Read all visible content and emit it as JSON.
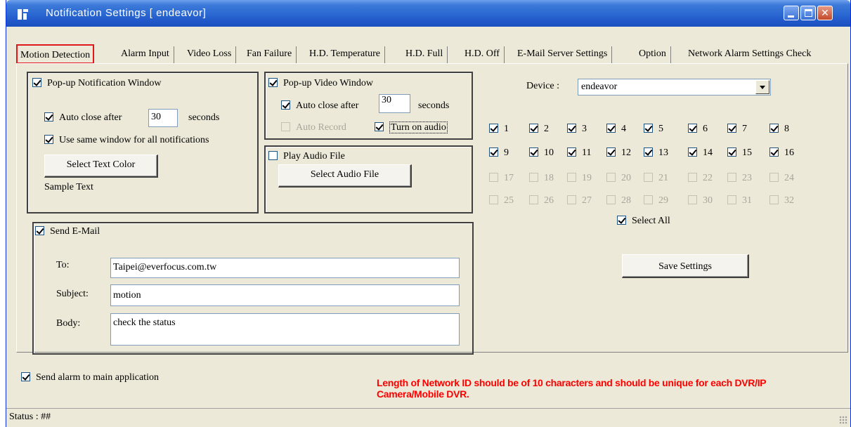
{
  "window": {
    "title": "Notification Settings  [ endeavor]"
  },
  "tabs": [
    {
      "label": "Motion Detection",
      "active": true
    },
    {
      "label": "Alarm Input"
    },
    {
      "label": "Video Loss"
    },
    {
      "label": "Fan Failure"
    },
    {
      "label": "H.D. Temperature"
    },
    {
      "label": "H.D. Full"
    },
    {
      "label": "H.D. Off"
    },
    {
      "label": "E-Mail Server Settings"
    },
    {
      "label": "Option"
    },
    {
      "label": "Network Alarm Settings Check"
    }
  ],
  "popup_notification": {
    "label": "Pop-up Notification Window",
    "checked": true,
    "auto_close_label": "Auto close after",
    "auto_close_value": "30",
    "seconds_label": "seconds",
    "same_window_label": "Use same window for all notifications",
    "select_color_button": "Select Text Color",
    "sample_text": "Sample Text"
  },
  "popup_video": {
    "label": "Pop-up Video Window",
    "auto_close_label": "Auto close after",
    "auto_close_value": "30",
    "seconds_label": "seconds",
    "auto_record_label": "Auto Record",
    "turn_on_audio_label": "Turn on audio"
  },
  "play_audio": {
    "label": "Play Audio File",
    "button": "Select Audio File"
  },
  "send_email": {
    "label": "Send E-Mail",
    "to_label": "To:",
    "to_value": "Taipei@everfocus.com.tw",
    "subject_label": "Subject:",
    "subject_value": "motion",
    "body_label": "Body:",
    "body_value": "check the status"
  },
  "device": {
    "label": "Device :",
    "value": "endeavor"
  },
  "channels": {
    "labels": [
      "1",
      "2",
      "3",
      "4",
      "5",
      "6",
      "7",
      "8",
      "9",
      "10",
      "11",
      "12",
      "13",
      "14",
      "15",
      "16",
      "17",
      "18",
      "19",
      "20",
      "21",
      "22",
      "23",
      "24",
      "25",
      "26",
      "27",
      "28",
      "29",
      "30",
      "31",
      "32"
    ],
    "checked_count": 16,
    "select_all_label": "Select All"
  },
  "save_button": "Save Settings",
  "send_alarm_label": "Send alarm to main application",
  "warning_line1": "Length of Network ID should be of 10 characters and should be unique for each DVR/IP",
  "warning_line2": "Camera/Mobile DVR.",
  "status_text": "Status : ##",
  "colors": {
    "titlebar": "#2a67d2",
    "window_bg": "#ece9d8",
    "active_tab_border": "#e0181b",
    "warning": "#ff0000"
  }
}
